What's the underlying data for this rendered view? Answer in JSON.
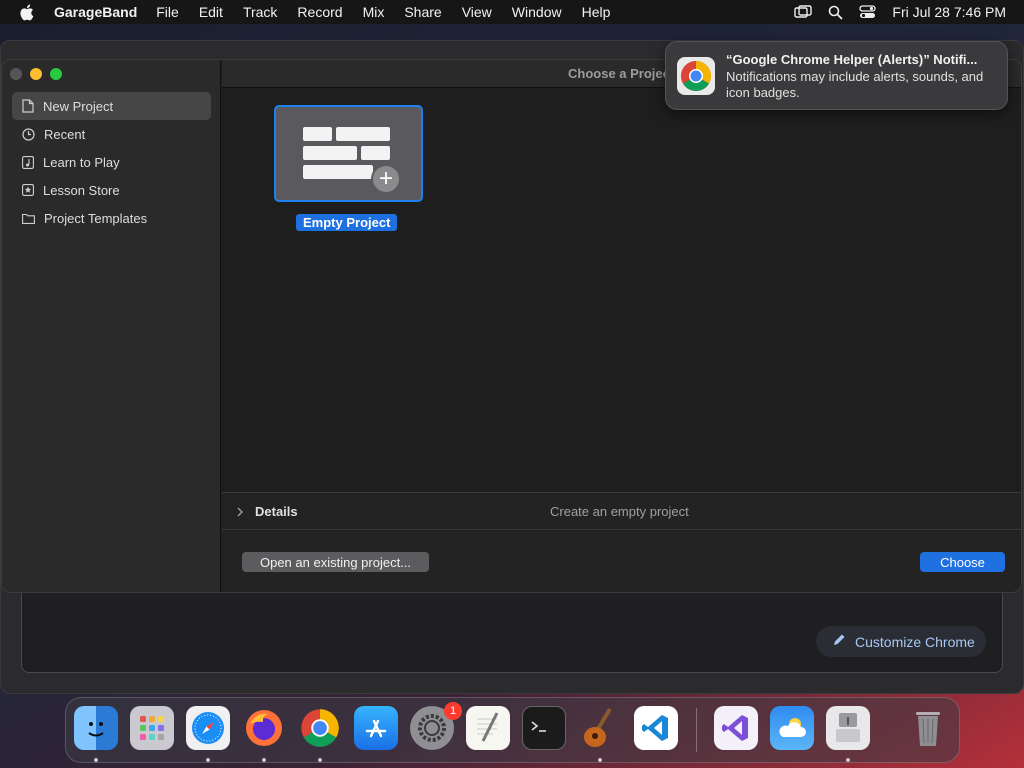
{
  "menubar": {
    "app_name": "GarageBand",
    "items": [
      "File",
      "Edit",
      "Track",
      "Record",
      "Mix",
      "Share",
      "View",
      "Window",
      "Help"
    ],
    "clock": "Fri Jul 28  7:46 PM"
  },
  "background_window": {
    "customize_label": "Customize Chrome"
  },
  "dialog": {
    "title": "Choose a Project",
    "sidebar": [
      {
        "label": "New Project",
        "icon": "document-icon",
        "selected": true
      },
      {
        "label": "Recent",
        "icon": "clock-icon",
        "selected": false
      },
      {
        "label": "Learn to Play",
        "icon": "music-note-icon",
        "selected": false
      },
      {
        "label": "Lesson Store",
        "icon": "star-icon",
        "selected": false
      },
      {
        "label": "Project Templates",
        "icon": "folder-icon",
        "selected": false
      }
    ],
    "template_tile": {
      "label": "Empty Project"
    },
    "details": {
      "label": "Details",
      "description": "Create an empty project"
    },
    "buttons": {
      "open_existing": "Open an existing project...",
      "choose": "Choose"
    }
  },
  "notification": {
    "title": "“Google Chrome Helper (Alerts)” Notifi...",
    "body": "Notifications may include alerts, sounds, and icon badges."
  },
  "dock": {
    "apps": [
      "Finder",
      "Launchpad",
      "Safari",
      "Firefox",
      "Google Chrome",
      "App Store",
      "System Settings",
      "TextEdit",
      "Terminal",
      "GarageBand",
      "Visual Studio Code",
      "Visual Studio",
      "Weather",
      "Disk Utility",
      "Trash"
    ],
    "system_settings_badge": "1"
  },
  "colors": {
    "accent": "#1e6fe0",
    "menubar": "#161616",
    "dialog_bg": "#1f1f1f"
  }
}
